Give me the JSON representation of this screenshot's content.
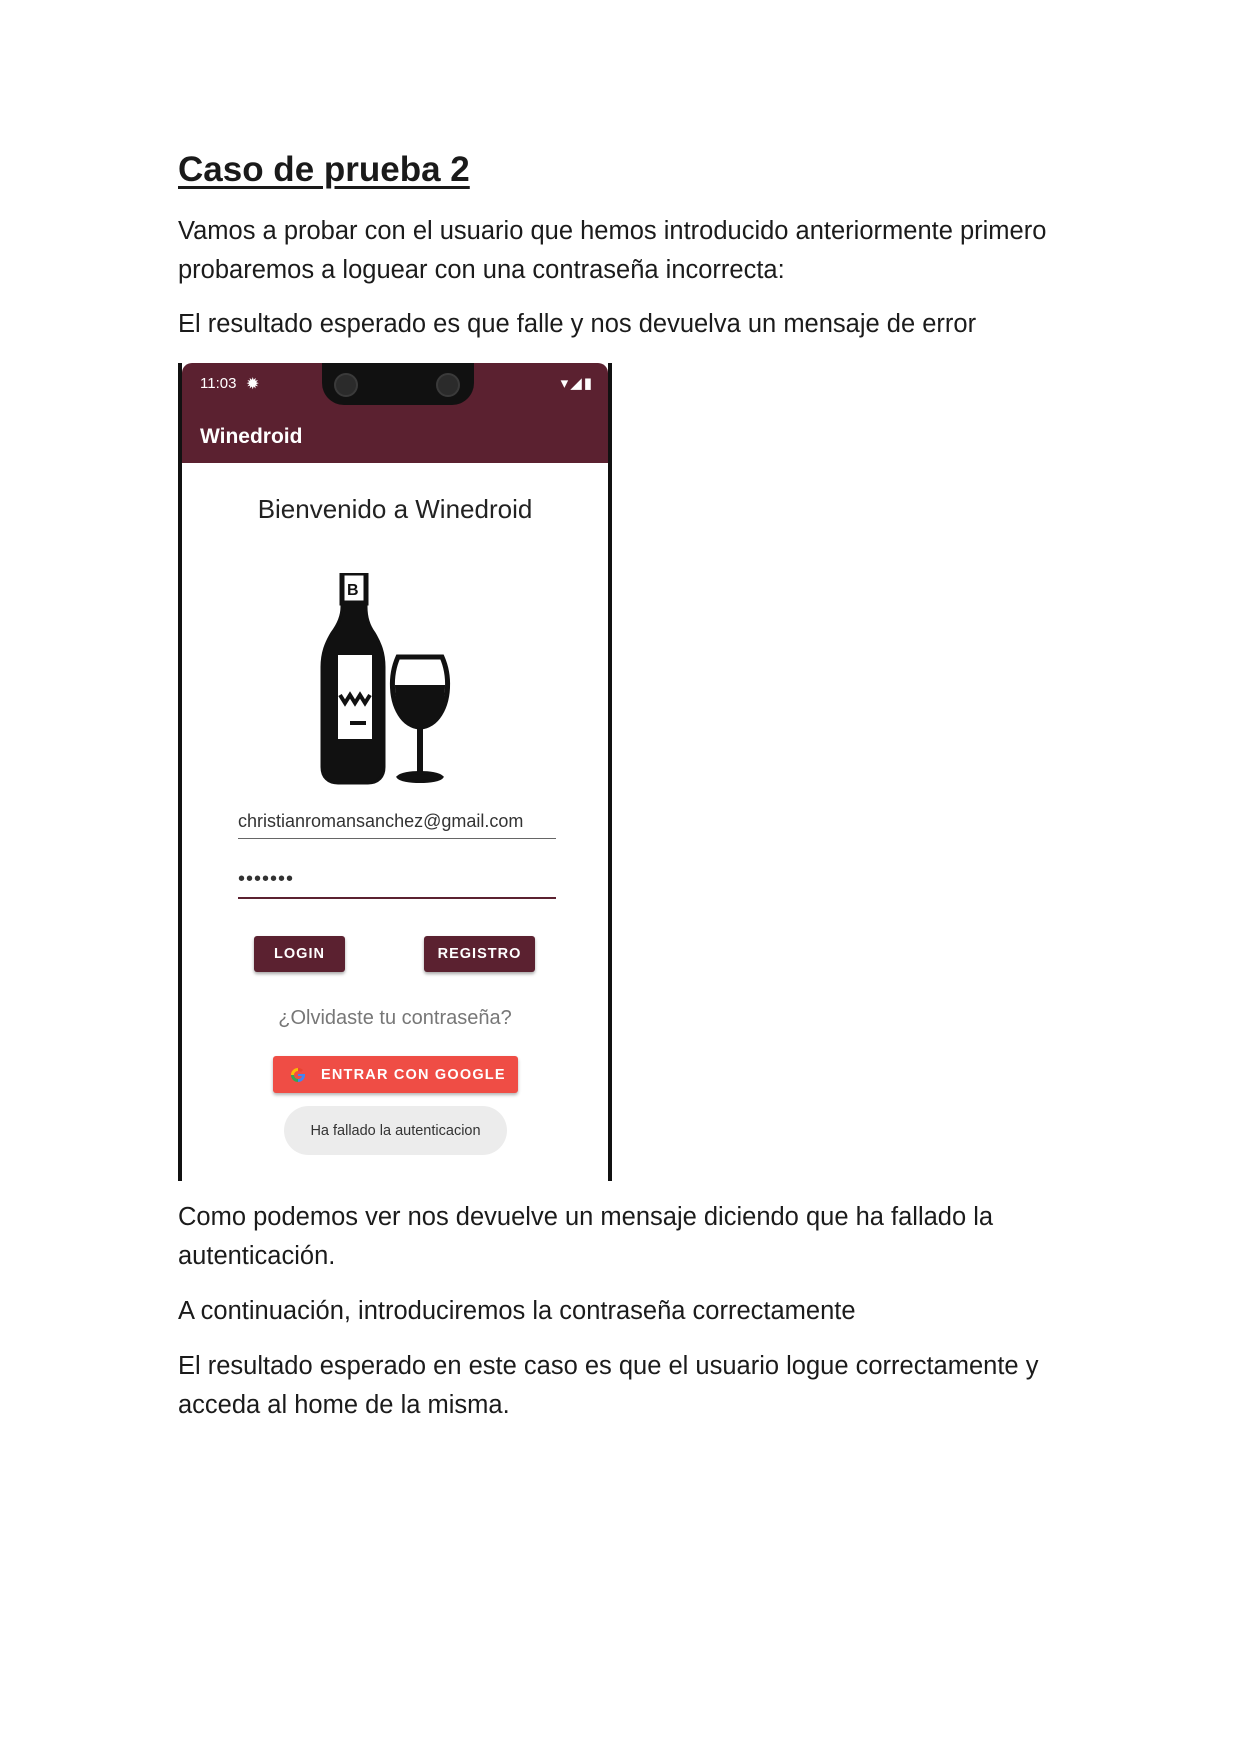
{
  "document": {
    "title": "Caso de prueba 2",
    "intro": "Vamos a probar con el usuario que hemos introducido anteriormente primero probaremos a loguear con una contraseña incorrecta:",
    "expected_1": "El resultado esperado es que falle y nos devuelva un mensaje de error",
    "observation": "Como podemos ver nos devuelve un mensaje diciendo que ha fallado la autenticación.",
    "next_step": "A continuación, introduciremos la contraseña correctamente",
    "expected_2": "El resultado esperado en este caso es que el usuario logue correctamente y acceda al home de la misma."
  },
  "phone": {
    "status_time": "11:03",
    "app_title": "Winedroid",
    "welcome": "Bienvenido a Winedroid",
    "email_value": "christianromansanchez@gmail.com",
    "password_value": "•••••••",
    "login_label": "LOGIN",
    "registro_label": "REGISTRO",
    "forgot_label": "¿Olvidaste tu contraseña?",
    "google_label": "ENTRAR CON GOOGLE",
    "toast": "Ha fallado la autenticacion",
    "logo_label": "B",
    "colors": {
      "primary": "#5b2130",
      "google": "#ef4d45"
    }
  }
}
